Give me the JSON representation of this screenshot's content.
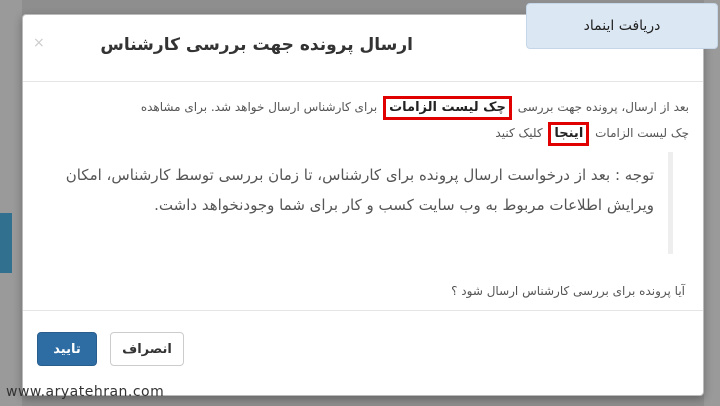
{
  "tooltip": {
    "label": "دریافت اینماد"
  },
  "modal": {
    "title": "ارسال پرونده جهت بررسی کارشناس",
    "close_symbol": "×",
    "intro_before": "بعد از ارسال، پرونده جهت بررسی",
    "checklist_link": "چک لیست الزامات",
    "intro_after": "برای کارشناس ارسال خواهد شد. برای مشاهده",
    "intro_line2_before": "چک لیست الزامات",
    "here_link": "اینجا",
    "intro_line2_after": "کلیک کنید",
    "note": "توجه : بعد از درخواست ارسال پرونده برای کارشناس، تا زمان بررسی توسط کارشناس، امکان ویرایش اطلاعات مربوط به وب سایت کسب و کار برای شما وجودنخواهد داشت.",
    "question": "آیا پرونده برای بررسی کارشناس ارسال شود ؟",
    "cancel_label": "انصراف",
    "confirm_label": "تایید"
  },
  "watermark": "www.aryatehran.com",
  "colors": {
    "highlight_border": "#e00000",
    "primary": "#2e6da4",
    "tooltip_bg": "#dbe7f3"
  }
}
